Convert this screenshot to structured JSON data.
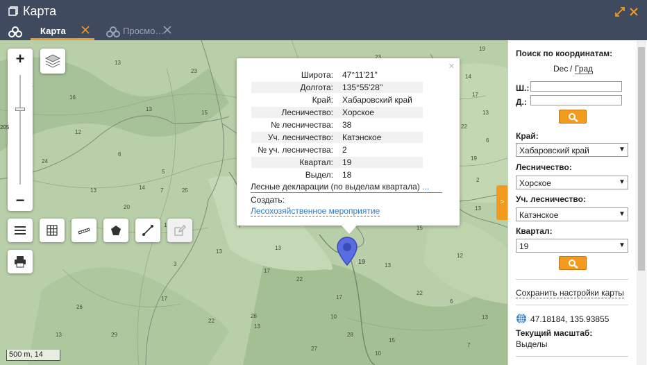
{
  "window": {
    "title": "Карта",
    "icon": "window-icon",
    "accent": "#f39b1e",
    "background": "#3f4a5f"
  },
  "tabs": [
    {
      "label": "Карта",
      "active": true
    },
    {
      "label": "Просмо…",
      "active": false
    }
  ],
  "map": {
    "zoom_in": "+",
    "zoom_out": "−",
    "zoom_side_label": "205",
    "scale": "500 m, 14",
    "quarter_numbers": [
      "13",
      "23",
      "11",
      "13",
      "15",
      "12",
      "13",
      "14",
      "5",
      "7",
      "25",
      "20",
      "18",
      "13",
      "3",
      "13",
      "17",
      "22",
      "17",
      "17",
      "26",
      "10",
      "28",
      "27",
      "13",
      "13",
      "15",
      "22",
      "12",
      "6",
      "15",
      "10",
      "7",
      "19",
      "14",
      "17",
      "13",
      "22",
      "6",
      "19",
      "2",
      "13",
      "12",
      "13",
      "16",
      "6",
      "24",
      "26",
      "29",
      "13",
      "22",
      "24",
      "23"
    ],
    "marker_label": "19",
    "tools": [
      "menu-icon",
      "grid-icon",
      "ruler-icon",
      "polygon-icon",
      "line-icon",
      "edit-icon"
    ],
    "print": "print-icon"
  },
  "popup": {
    "rows": [
      {
        "k": "Широта:",
        "v": "47°11'21''"
      },
      {
        "k": "Долгота:",
        "v": "135°55'28''"
      },
      {
        "k": "Край:",
        "v": "Хабаровский край"
      },
      {
        "k": "Лесничество:",
        "v": "Хорское"
      },
      {
        "k": "№ лесничества:",
        "v": "38"
      },
      {
        "k": "Уч. лесничество:",
        "v": "Катэнское"
      },
      {
        "k": "№ уч. лесничества:",
        "v": "2"
      },
      {
        "k": "Квартал:",
        "v": "19"
      },
      {
        "k": "Выдел:",
        "v": "18"
      }
    ],
    "declarations": "Лесные декларации (по выделам квартала)",
    "more": "...",
    "create_label": "Создать:",
    "create_link": "Лесохозяйственное мероприятие",
    "close": "×"
  },
  "panel": {
    "coord_search_title": "Поиск по координатам:",
    "format_dec": "Dec",
    "format_sep": "/",
    "format_grad": "Град",
    "lat_label": "Ш.:",
    "lon_label": "Д.:",
    "lat_value": "",
    "lon_value": "",
    "region_label": "Край:",
    "region_value": "Хабаровский край",
    "forestry_label": "Лесничество:",
    "forestry_value": "Хорское",
    "district_label": "Уч. лесничество:",
    "district_value": "Катэнское",
    "quarter_label": "Квартал:",
    "quarter_value": "19",
    "save_settings": "Сохранить настройки карты",
    "cursor_coords": "47.18184, 135.93855",
    "current_scale_label": "Текущий масштаб:",
    "current_scale_value": "Выделы",
    "collapse": ">"
  }
}
